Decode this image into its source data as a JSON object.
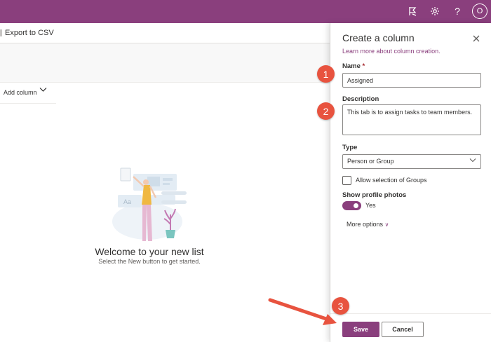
{
  "topbar": {
    "icons": [
      "feedback-icon",
      "gear-icon",
      "help-icon"
    ],
    "help_glyph": "?",
    "avatar_initial": "O",
    "color": "#8a3f7d"
  },
  "commandbar": {
    "export_label": "Export to CSV"
  },
  "list": {
    "add_column_label": "Add column",
    "welcome_title": "Welcome to your new list",
    "welcome_subtitle": "Select the New button to get started.",
    "illustration_text": "Aa"
  },
  "panel": {
    "title": "Create a column",
    "learn_more": "Learn more about column creation.",
    "name_label": "Name",
    "required_mark": "*",
    "name_value": "Assigned",
    "description_label": "Description",
    "description_value": "This tab is to assign tasks to team members.",
    "type_label": "Type",
    "type_value": "Person or Group",
    "allow_groups_label": "Allow selection of Groups",
    "allow_groups_checked": false,
    "profile_photos_label": "Show profile photos",
    "profile_photos_value": "Yes",
    "profile_photos_on": true,
    "more_options": "More options",
    "save_label": "Save",
    "cancel_label": "Cancel"
  },
  "annotations": {
    "badges": [
      "1",
      "2",
      "3"
    ],
    "color": "#e8533f"
  }
}
